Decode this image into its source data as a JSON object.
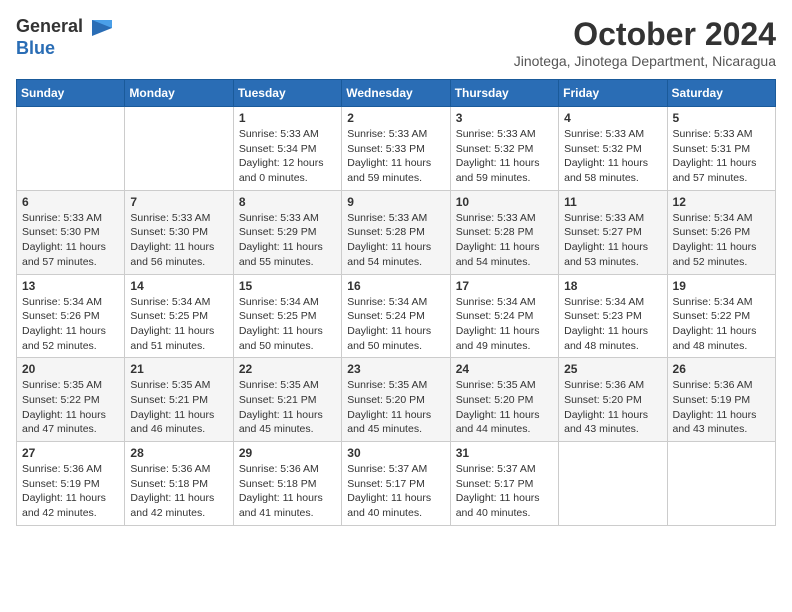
{
  "logo": {
    "general": "General",
    "blue": "Blue"
  },
  "title": "October 2024",
  "location": "Jinotega, Jinotega Department, Nicaragua",
  "headers": [
    "Sunday",
    "Monday",
    "Tuesday",
    "Wednesday",
    "Thursday",
    "Friday",
    "Saturday"
  ],
  "weeks": [
    [
      {
        "day": "",
        "info": ""
      },
      {
        "day": "",
        "info": ""
      },
      {
        "day": "1",
        "info": "Sunrise: 5:33 AM\nSunset: 5:34 PM\nDaylight: 12 hours\nand 0 minutes."
      },
      {
        "day": "2",
        "info": "Sunrise: 5:33 AM\nSunset: 5:33 PM\nDaylight: 11 hours\nand 59 minutes."
      },
      {
        "day": "3",
        "info": "Sunrise: 5:33 AM\nSunset: 5:32 PM\nDaylight: 11 hours\nand 59 minutes."
      },
      {
        "day": "4",
        "info": "Sunrise: 5:33 AM\nSunset: 5:32 PM\nDaylight: 11 hours\nand 58 minutes."
      },
      {
        "day": "5",
        "info": "Sunrise: 5:33 AM\nSunset: 5:31 PM\nDaylight: 11 hours\nand 57 minutes."
      }
    ],
    [
      {
        "day": "6",
        "info": "Sunrise: 5:33 AM\nSunset: 5:30 PM\nDaylight: 11 hours\nand 57 minutes."
      },
      {
        "day": "7",
        "info": "Sunrise: 5:33 AM\nSunset: 5:30 PM\nDaylight: 11 hours\nand 56 minutes."
      },
      {
        "day": "8",
        "info": "Sunrise: 5:33 AM\nSunset: 5:29 PM\nDaylight: 11 hours\nand 55 minutes."
      },
      {
        "day": "9",
        "info": "Sunrise: 5:33 AM\nSunset: 5:28 PM\nDaylight: 11 hours\nand 54 minutes."
      },
      {
        "day": "10",
        "info": "Sunrise: 5:33 AM\nSunset: 5:28 PM\nDaylight: 11 hours\nand 54 minutes."
      },
      {
        "day": "11",
        "info": "Sunrise: 5:33 AM\nSunset: 5:27 PM\nDaylight: 11 hours\nand 53 minutes."
      },
      {
        "day": "12",
        "info": "Sunrise: 5:34 AM\nSunset: 5:26 PM\nDaylight: 11 hours\nand 52 minutes."
      }
    ],
    [
      {
        "day": "13",
        "info": "Sunrise: 5:34 AM\nSunset: 5:26 PM\nDaylight: 11 hours\nand 52 minutes."
      },
      {
        "day": "14",
        "info": "Sunrise: 5:34 AM\nSunset: 5:25 PM\nDaylight: 11 hours\nand 51 minutes."
      },
      {
        "day": "15",
        "info": "Sunrise: 5:34 AM\nSunset: 5:25 PM\nDaylight: 11 hours\nand 50 minutes."
      },
      {
        "day": "16",
        "info": "Sunrise: 5:34 AM\nSunset: 5:24 PM\nDaylight: 11 hours\nand 50 minutes."
      },
      {
        "day": "17",
        "info": "Sunrise: 5:34 AM\nSunset: 5:24 PM\nDaylight: 11 hours\nand 49 minutes."
      },
      {
        "day": "18",
        "info": "Sunrise: 5:34 AM\nSunset: 5:23 PM\nDaylight: 11 hours\nand 48 minutes."
      },
      {
        "day": "19",
        "info": "Sunrise: 5:34 AM\nSunset: 5:22 PM\nDaylight: 11 hours\nand 48 minutes."
      }
    ],
    [
      {
        "day": "20",
        "info": "Sunrise: 5:35 AM\nSunset: 5:22 PM\nDaylight: 11 hours\nand 47 minutes."
      },
      {
        "day": "21",
        "info": "Sunrise: 5:35 AM\nSunset: 5:21 PM\nDaylight: 11 hours\nand 46 minutes."
      },
      {
        "day": "22",
        "info": "Sunrise: 5:35 AM\nSunset: 5:21 PM\nDaylight: 11 hours\nand 45 minutes."
      },
      {
        "day": "23",
        "info": "Sunrise: 5:35 AM\nSunset: 5:20 PM\nDaylight: 11 hours\nand 45 minutes."
      },
      {
        "day": "24",
        "info": "Sunrise: 5:35 AM\nSunset: 5:20 PM\nDaylight: 11 hours\nand 44 minutes."
      },
      {
        "day": "25",
        "info": "Sunrise: 5:36 AM\nSunset: 5:20 PM\nDaylight: 11 hours\nand 43 minutes."
      },
      {
        "day": "26",
        "info": "Sunrise: 5:36 AM\nSunset: 5:19 PM\nDaylight: 11 hours\nand 43 minutes."
      }
    ],
    [
      {
        "day": "27",
        "info": "Sunrise: 5:36 AM\nSunset: 5:19 PM\nDaylight: 11 hours\nand 42 minutes."
      },
      {
        "day": "28",
        "info": "Sunrise: 5:36 AM\nSunset: 5:18 PM\nDaylight: 11 hours\nand 42 minutes."
      },
      {
        "day": "29",
        "info": "Sunrise: 5:36 AM\nSunset: 5:18 PM\nDaylight: 11 hours\nand 41 minutes."
      },
      {
        "day": "30",
        "info": "Sunrise: 5:37 AM\nSunset: 5:17 PM\nDaylight: 11 hours\nand 40 minutes."
      },
      {
        "day": "31",
        "info": "Sunrise: 5:37 AM\nSunset: 5:17 PM\nDaylight: 11 hours\nand 40 minutes."
      },
      {
        "day": "",
        "info": ""
      },
      {
        "day": "",
        "info": ""
      }
    ]
  ]
}
